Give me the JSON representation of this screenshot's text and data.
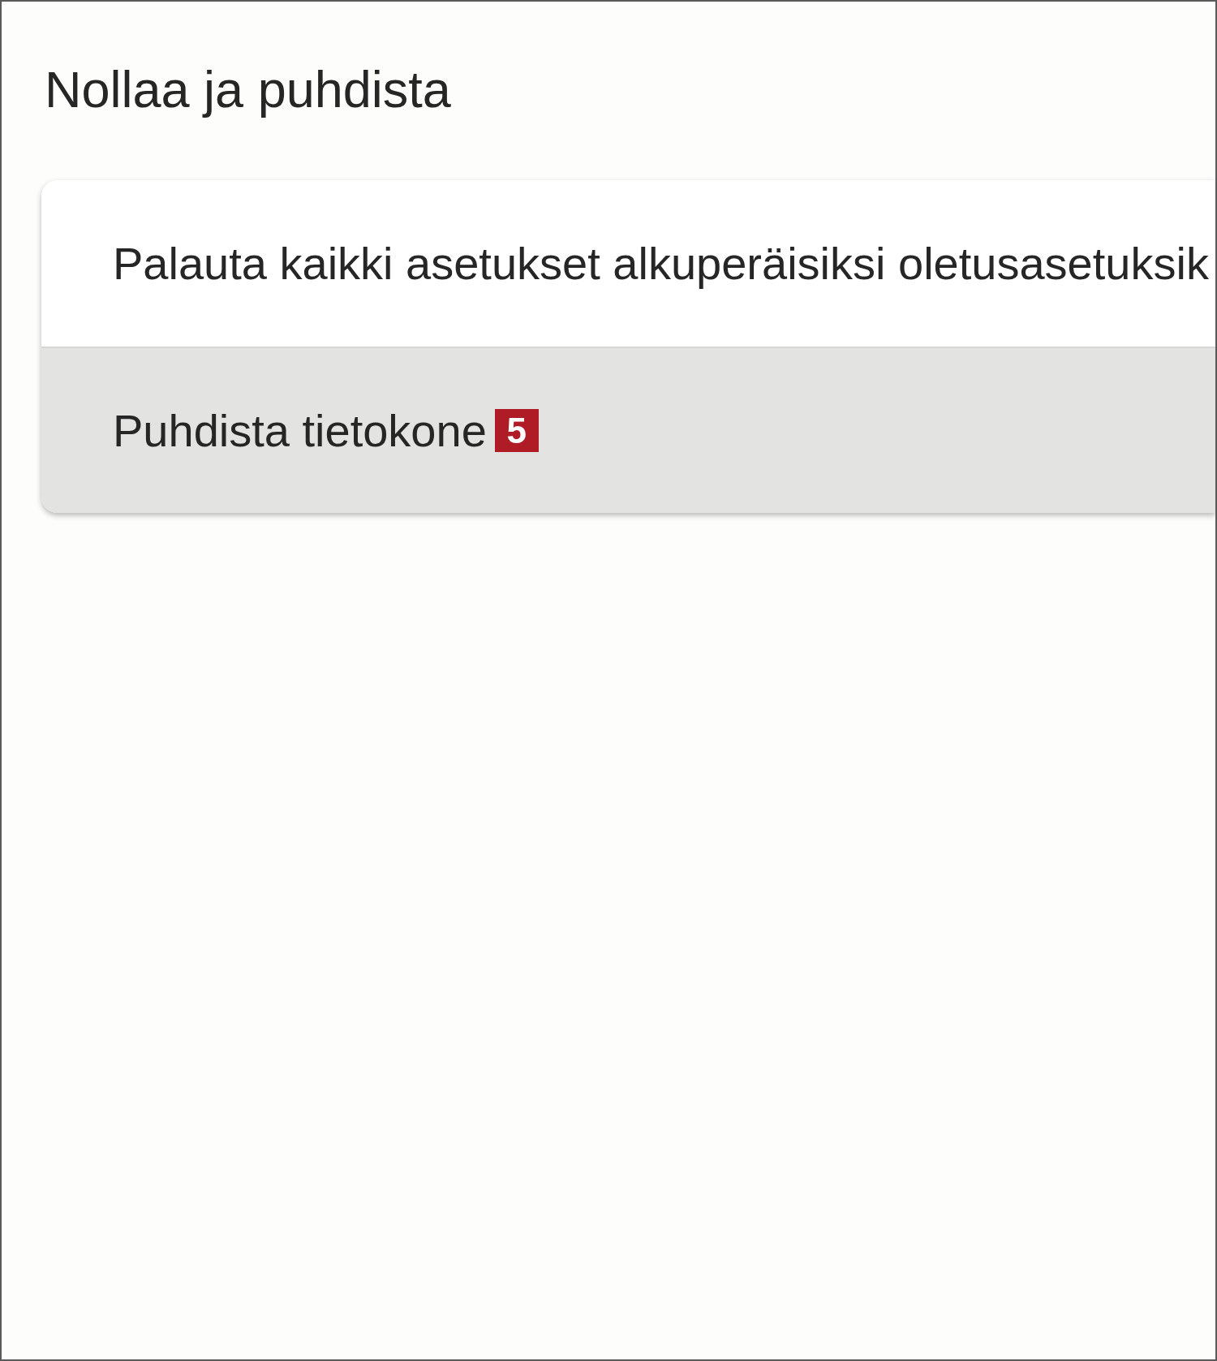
{
  "page": {
    "title": "Nollaa ja puhdista"
  },
  "options": [
    {
      "label": "Palauta kaikki asetukset alkuperäisiksi oletusasetuksik",
      "selected": false
    },
    {
      "label": "Puhdista tietokone",
      "selected": true,
      "badge": "5"
    }
  ]
}
